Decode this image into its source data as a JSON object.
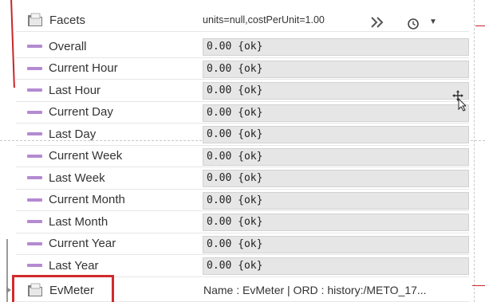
{
  "header": {
    "label": "Facets",
    "value": "units=null,costPerUnit=1.00"
  },
  "rows": [
    {
      "label": "Overall",
      "value": "0.00 {ok}"
    },
    {
      "label": "Current Hour",
      "value": "0.00 {ok}"
    },
    {
      "label": "Last Hour",
      "value": "0.00 {ok}"
    },
    {
      "label": "Current Day",
      "value": "0.00 {ok}"
    },
    {
      "label": "Last Day",
      "value": "0.00 {ok}"
    },
    {
      "label": "Current Week",
      "value": "0.00 {ok}"
    },
    {
      "label": "Last Week",
      "value": "0.00 {ok}"
    },
    {
      "label": "Current Month",
      "value": "0.00 {ok}"
    },
    {
      "label": "Last Month",
      "value": "0.00 {ok}"
    },
    {
      "label": "Current Year",
      "value": "0.00 {ok}"
    },
    {
      "label": "Last Year",
      "value": "0.00 {ok}"
    }
  ],
  "evmeter": {
    "label": "EvMeter",
    "value": "Name : EvMeter | ORD : history:/METO_17..."
  },
  "icons": {
    "folder": "folder-icon",
    "chevrons": "double-chevron-right-icon",
    "history": "history-clock-icon",
    "dropdown": "caret-down-icon",
    "cursor": "move-cursor-icon"
  },
  "colors": {
    "dash": "#b48ad2",
    "highlight": "#d22a2d"
  }
}
